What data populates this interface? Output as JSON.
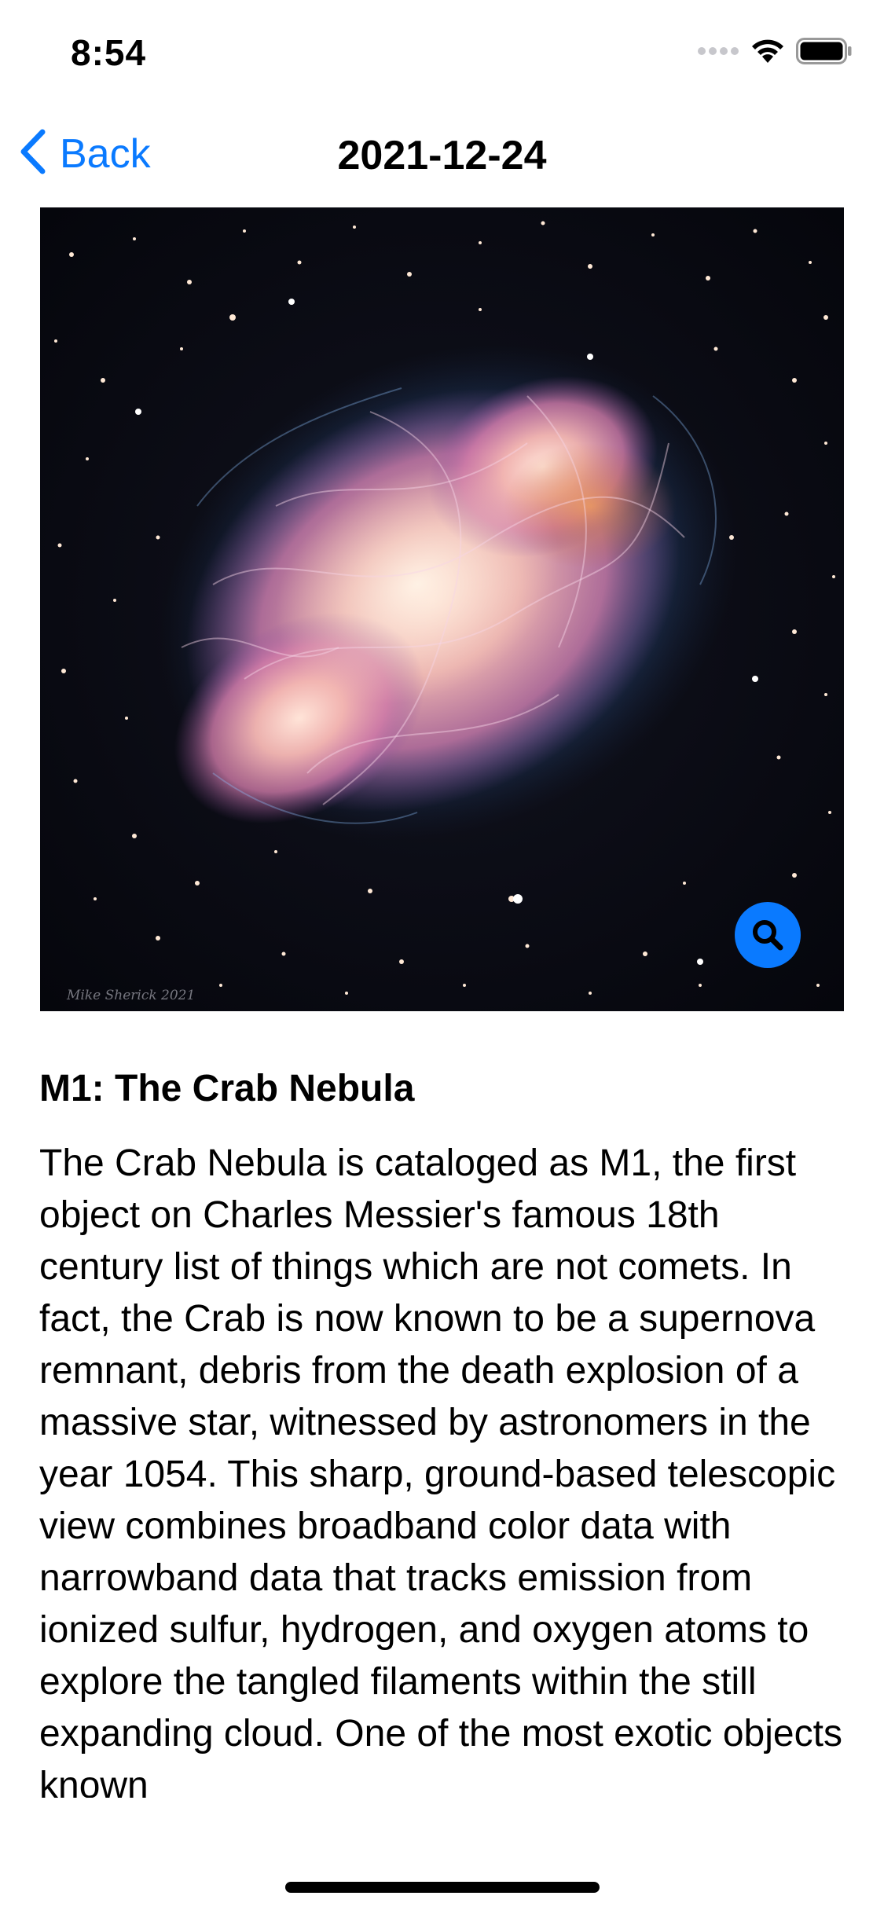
{
  "status_bar": {
    "time": "8:54"
  },
  "nav": {
    "back_label": "Back",
    "title": "2021-12-24"
  },
  "image": {
    "credit": "Mike Sherick 2021",
    "zoom_icon": "magnifying-glass-icon"
  },
  "article": {
    "title": "M1: The Crab Nebula",
    "explanation": "The Crab Nebula is cataloged as M1, the first object on Charles Messier's famous 18th century list of things which are not comets. In fact, the Crab is now known to be a supernova remnant, debris from the death explosion of a massive star, witnessed by astronomers in the year 1054. This sharp, ground-based telescopic view combines broadband color data with narrowband data that tracks emission from ionized sulfur, hydrogen, and oxygen atoms to explore the tangled filaments within the still expanding cloud. One of the most exotic objects known"
  },
  "colors": {
    "accent": "#0a7aff",
    "background": "#ffffff",
    "text": "#000000"
  }
}
